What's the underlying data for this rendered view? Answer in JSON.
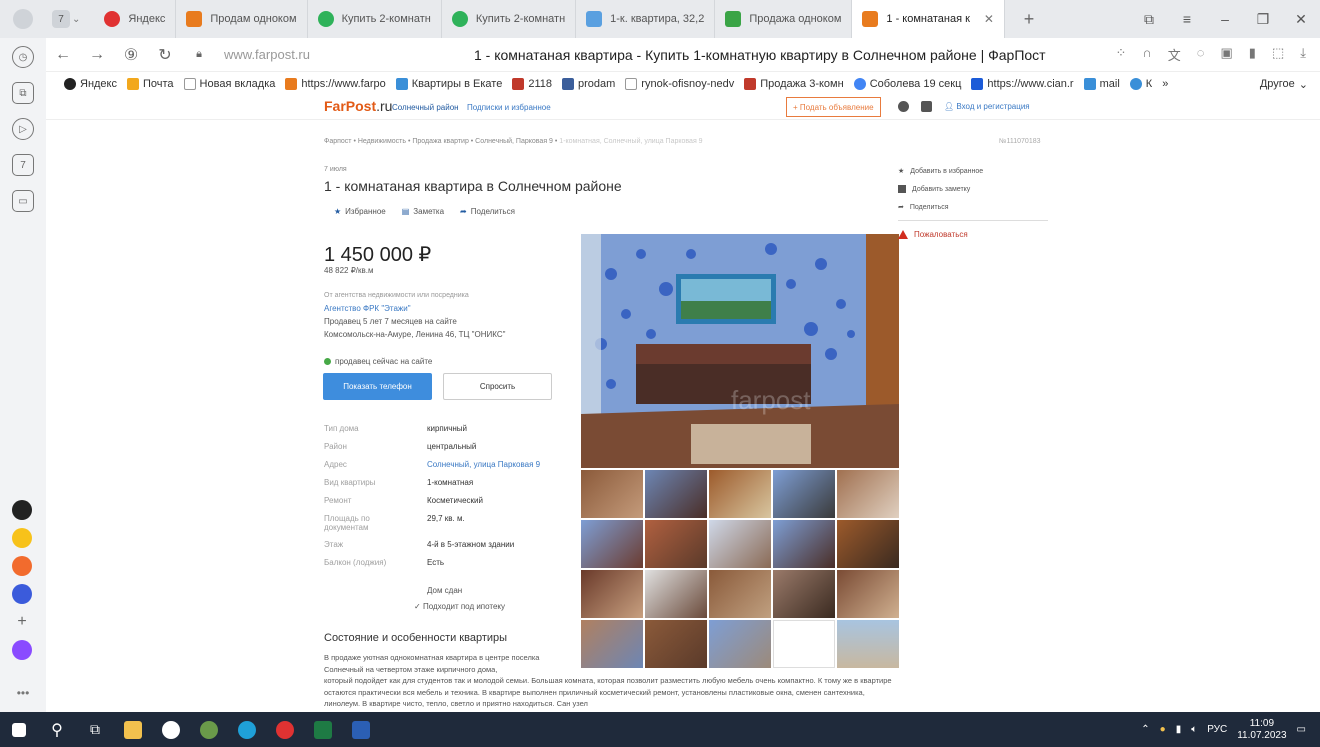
{
  "browser": {
    "tab_counter": "7",
    "tabs": [
      {
        "label": "Яндекс",
        "color": "#e03232"
      },
      {
        "label": "Продам одноком",
        "color": "#e87b1e"
      },
      {
        "label": "Купить 2-комнатн",
        "color": "#2fb25a"
      },
      {
        "label": "Купить 2-комнатн",
        "color": "#2fb25a"
      },
      {
        "label": "1-к. квартира, 32,2",
        "color": "#5aa0e0"
      },
      {
        "label": "Продажа одноком",
        "color": "#3aa446"
      },
      {
        "label": "1 - комнатаная к",
        "color": "#e87b1e",
        "active": true
      }
    ],
    "url": "www.farpost.ru",
    "page_title": "1 - комнатаная квартира - Купить 1-комнатную квартиру в Солнечном районе | ФарПост",
    "bookmarks": [
      {
        "label": "Яндекс",
        "color": "#222"
      },
      {
        "label": "Почта",
        "color": "#f2a81d"
      },
      {
        "label": "Новая вкладка",
        "color": "#aaa"
      },
      {
        "label": "https://www.farpo",
        "color": "#e87b1e"
      },
      {
        "label": "Квартиры в Екате",
        "color": "#3a8fd8"
      },
      {
        "label": "2118",
        "color": "#c0392b"
      },
      {
        "label": "prodam",
        "color": "#3b5e9b"
      },
      {
        "label": "rynok-ofisnoy-nedv",
        "color": "#aaa"
      },
      {
        "label": "Продажа 3-комн",
        "color": "#c0392b"
      },
      {
        "label": "Соболева 19 секц",
        "color": "#4285f4"
      },
      {
        "label": "https://www.cian.r",
        "color": "#1c5bd8"
      },
      {
        "label": "mail",
        "color": "#3a8fd8"
      },
      {
        "label": "К",
        "color": "#3a8fd8"
      },
      {
        "label": "»",
        "color": "transparent"
      }
    ],
    "bookmarks_other": "Другое"
  },
  "site": {
    "logo_main": "FarPost",
    "logo_suffix": ".ru",
    "region": "Солнечный район",
    "subscriptions": "Подписки и избранное",
    "post_button": "+ Подать объявление",
    "login": "Вход и регистрация"
  },
  "listing": {
    "breadcrumbs": "Фарпост • Недвижимость • Продажа квартир • Солнечный, Парковая 9 •",
    "breadcrumbs_last": "1-комнатная, Солнечный, улица Парковая 9",
    "ad_number": "№111070183",
    "date": "7 июля",
    "title": "1 - комнатаная квартира в Солнечном районе",
    "actions": {
      "favorite": "Избранное",
      "note": "Заметка",
      "share": "Поделиться"
    },
    "price": "1 450 000 ₽",
    "price_per_m2": "48 822 ₽/кв.м",
    "agency_note": "От агентства недвижимости или посредника",
    "agency": "Агентство ФРК \"Этажи\"",
    "seller_age": "Продавец 5 лет 7 месяцев на сайте",
    "seller_address": "Комсомольск-на-Амуре, Ленина 46, ТЦ \"ОНИКС\"",
    "online": "продавец сейчас на сайте",
    "btn_phone": "Показать телефон",
    "btn_ask": "Спросить",
    "specs": [
      {
        "k": "Тип дома",
        "v": "кирпичный"
      },
      {
        "k": "Район",
        "v": "центральный"
      },
      {
        "k": "Адрес",
        "v": "Солнечный, улица Парковая 9",
        "link": true
      },
      {
        "k": "Вид квартиры",
        "v": "1-комнатная"
      },
      {
        "k": "Ремонт",
        "v": "Косметический"
      },
      {
        "k": "Площадь по документам",
        "v": "29,7 кв. м.",
        "tall": true
      },
      {
        "k": "Этаж",
        "v": "4-й в 5-этажном здании"
      },
      {
        "k": "Балкон (лоджия)",
        "v": "Есть"
      }
    ],
    "extra_1": "Дом сдан",
    "extra_2": "Подходит под ипотеку",
    "section_heading": "Состояние и особенности квартиры",
    "description_1": "В продаже уютная однокомнатная квартира в центре поселка Солнечный на четвертом этаже кирпичного дома,",
    "description_2": "который подойдет как для студентов так и молодой семьи. Большая комната, которая позволит разместить любую мебель очень компактно. К тому же в квартире остаются практически вся мебель и техника. В квартире выполнен приличный косметический ремонт, установлены пластиковые окна, сменен сантехника, линолеум. В квартире чисто, тепло, светло и приятно находиться. Сан узел",
    "right": {
      "add_fav": "Добавить в избранное",
      "add_note": "Добавить заметку",
      "share": "Поделиться",
      "report": "Пожаловаться"
    }
  },
  "taskbar": {
    "lang": "РУС",
    "time": "11:09",
    "date": "11.07.2023"
  }
}
